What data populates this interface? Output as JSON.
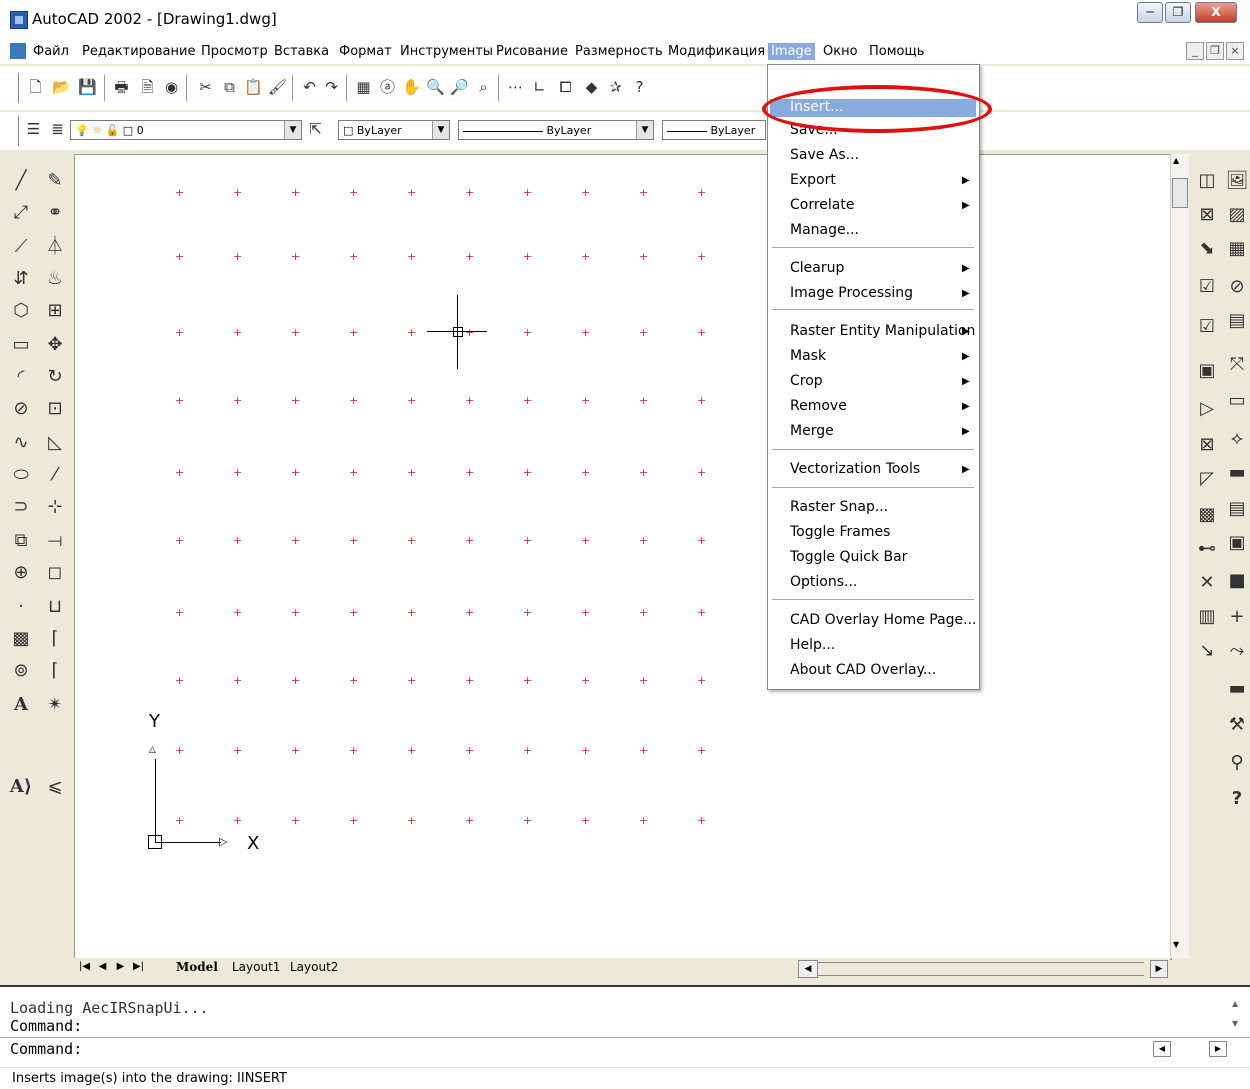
{
  "window": {
    "title": "AutoCAD 2002 - [Drawing1.dwg]",
    "min": "─",
    "restore": "❐",
    "close": "X"
  },
  "menubar": {
    "items": [
      "Файл",
      "Редактирование",
      "Просмотр",
      "Вставка",
      "Формат",
      "Инструменты",
      "Рисование",
      "Размерность",
      "Модификация",
      "Image",
      "Окно",
      "Помощь"
    ],
    "active": "Image",
    "mdi": [
      "_",
      "❐",
      "×"
    ]
  },
  "toolbar2": {
    "layer": "0",
    "color": "ByLayer",
    "linetype": "ByLayer",
    "lineweight": "ByLayer"
  },
  "image_menu": {
    "items": [
      {
        "label": "Insert...",
        "submenu": false,
        "highlighted": true
      },
      {
        "label": "Save...",
        "submenu": false
      },
      {
        "label": "Save As...",
        "submenu": false
      },
      {
        "label": "Export",
        "submenu": true
      },
      {
        "label": "Correlate",
        "submenu": true
      },
      {
        "label": "Manage...",
        "submenu": false
      },
      {
        "label": "Clearup",
        "submenu": true
      },
      {
        "label": "Image Processing",
        "submenu": true
      },
      {
        "label": "Raster Entity Manipulation",
        "submenu": true
      },
      {
        "label": "Mask",
        "submenu": true
      },
      {
        "label": "Crop",
        "submenu": true
      },
      {
        "label": "Remove",
        "submenu": true
      },
      {
        "label": "Merge",
        "submenu": true
      },
      {
        "label": "Vectorization Tools",
        "submenu": true
      },
      {
        "label": "Raster Snap...",
        "submenu": false
      },
      {
        "label": "Toggle Frames",
        "submenu": false
      },
      {
        "label": "Toggle Quick Bar",
        "submenu": false
      },
      {
        "label": "Options...",
        "submenu": false
      },
      {
        "label": "CAD Overlay Home Page...",
        "submenu": false
      },
      {
        "label": "Help...",
        "submenu": false
      },
      {
        "label": "About CAD Overlay...",
        "submenu": false
      }
    ],
    "submenu_arrow": "▶"
  },
  "canvas": {
    "ucs_y": "Y",
    "ucs_x": "X"
  },
  "layout_tabs": {
    "nav": [
      "|◀",
      "◀",
      "▶",
      "▶|"
    ],
    "tabs": [
      "Model",
      "Layout1",
      "Layout2"
    ],
    "active": "Model"
  },
  "command": {
    "lines": [
      "Loading AecIRSnapUi...",
      "Command:",
      "Command:"
    ]
  },
  "status": {
    "text": "Inserts image(s) into the drawing: IINSERT"
  },
  "colors": {
    "highlight": "#88aade",
    "grid_dot": "#d03030",
    "annotation": "#e01010"
  }
}
